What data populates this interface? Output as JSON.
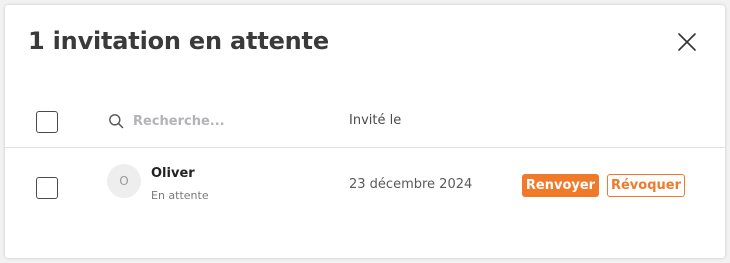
{
  "modal": {
    "title": "1 invitation en attente"
  },
  "table": {
    "search_placeholder": "Recherche...",
    "column_invited": "Invité le",
    "rows": [
      {
        "avatar_initial": "O",
        "name": "Oliver",
        "status": "En attente",
        "invited_date": "23 décembre 2024",
        "resend_label": "Renvoyer",
        "revoke_label": "Révoquer"
      }
    ]
  },
  "colors": {
    "accent": "#f07a2a",
    "title": "#3a3a3a"
  },
  "icons": [
    "close-icon",
    "search-icon"
  ]
}
